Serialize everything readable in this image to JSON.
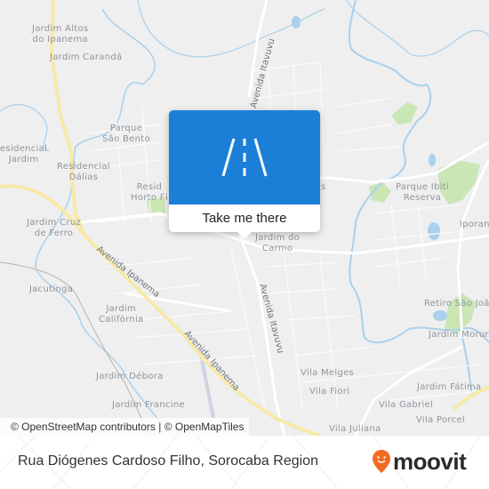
{
  "map": {
    "places": [
      {
        "name": "Jardim Altos\ndo Ipanema"
      },
      {
        "name": "Jardim Carandá"
      },
      {
        "name": "Parque\nSão Bento"
      },
      {
        "name": "esidencial\nJardim"
      },
      {
        "name": "Residencial\nDálias"
      },
      {
        "name": "Resid\nHorto Fl"
      },
      {
        "name": "Jardim Cruz\nde Ferro"
      },
      {
        "name": "Jacutinga"
      },
      {
        "name": "Jardim\nCalifórnia"
      },
      {
        "name": "Jardim Débora"
      },
      {
        "name": "Jardim Francine"
      },
      {
        "name": "Jardim do\nCarmo"
      },
      {
        "name": "Parque Ibiti\nReserva"
      },
      {
        "name": "Iporan"
      },
      {
        "name": "Retiro São Joã"
      },
      {
        "name": "Jardim Morur"
      },
      {
        "name": "Vila Melges"
      },
      {
        "name": "Vila Fiori"
      },
      {
        "name": "Jardim Fátima"
      },
      {
        "name": "Vila Gabriel"
      },
      {
        "name": "Vila Porcel"
      },
      {
        "name": "Vila Juliana"
      },
      {
        "name": "s"
      }
    ],
    "roads": [
      {
        "name": "Avenida Itavuvu"
      },
      {
        "name": "Avenida Ipanema"
      },
      {
        "name": "Avenida Ipanema"
      },
      {
        "name": "Avenida Itavuvu"
      }
    ],
    "colors": {
      "background": "#efefef",
      "water": "#a9d0ec",
      "park": "#c9e6b4",
      "highway": "#f7e9a8",
      "road": "#ffffff"
    }
  },
  "popup": {
    "icon": "road-icon",
    "button_label": "Take me there",
    "color": "#1b7fd8"
  },
  "attribution": "© OpenStreetMap contributors | © OpenMapTiles",
  "footer": {
    "title": "Rua Diógenes Cardoso Filho, Sorocaba Region",
    "brand": "moovit",
    "brand_color": "#f26b21"
  }
}
